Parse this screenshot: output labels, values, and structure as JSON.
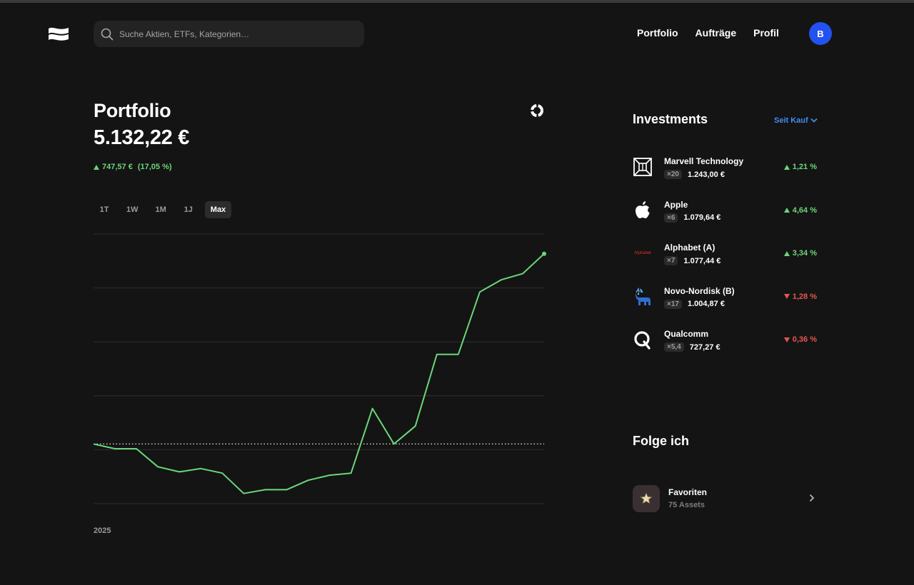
{
  "header": {
    "search_placeholder": "Suche Aktien, ETFs, Kategorien…",
    "nav": [
      "Portfolio",
      "Aufträge",
      "Profil"
    ],
    "avatar_initial": "B"
  },
  "portfolio": {
    "title": "Portfolio",
    "value": "5.132,22 €",
    "change_amount": "747,57 €",
    "change_percent": "(17,05 %)",
    "change_direction": "up",
    "ranges": [
      "1T",
      "1W",
      "1M",
      "1J",
      "Max"
    ],
    "active_range": "Max"
  },
  "chart_data": {
    "type": "line",
    "x_tick_labels": [
      "2025"
    ],
    "values": [
      4384.65,
      4366,
      4366,
      4295,
      4275,
      4288,
      4270,
      4190,
      4205,
      4205,
      4242,
      4262,
      4270,
      4524,
      4384.65,
      4455,
      4737,
      4737,
      4982,
      5030,
      5054,
      5132.22
    ],
    "baseline": 4384.65,
    "ylim": [
      4150,
      5210
    ],
    "grid": true,
    "line_color": "#6bd67a"
  },
  "investments": {
    "title": "Investments",
    "filter_label": "Seit Kauf",
    "items": [
      {
        "name": "Marvell Technology",
        "qty": "×20",
        "amount": "1.243,00 €",
        "perf": "1,21 %",
        "dir": "up",
        "icon": "marvell-logo"
      },
      {
        "name": "Apple",
        "qty": "×6",
        "amount": "1.079,64 €",
        "perf": "4,64 %",
        "dir": "up",
        "icon": "apple-logo"
      },
      {
        "name": "Alphabet (A)",
        "qty": "×7",
        "amount": "1.077,44 €",
        "perf": "3,34 %",
        "dir": "up",
        "icon": "alphabet-logo",
        "logo_text": "Alphabet"
      },
      {
        "name": "Novo-Nordisk (B)",
        "qty": "×17",
        "amount": "1.004,87 €",
        "perf": "1,28 %",
        "dir": "down",
        "icon": "novo-nordisk-logo"
      },
      {
        "name": "Qualcomm",
        "qty": "×5,4",
        "amount": "727,27 €",
        "perf": "0,36 %",
        "dir": "down",
        "icon": "qualcomm-logo"
      }
    ]
  },
  "following": {
    "title": "Folge ich",
    "items": [
      {
        "name": "Favoriten",
        "subtitle": "75 Assets",
        "icon": "star-icon"
      }
    ]
  },
  "colors": {
    "background": "#141414",
    "positive": "#6bd67a",
    "negative": "#e0594f",
    "accent": "#3f8ff0",
    "avatar": "#2352f0"
  }
}
